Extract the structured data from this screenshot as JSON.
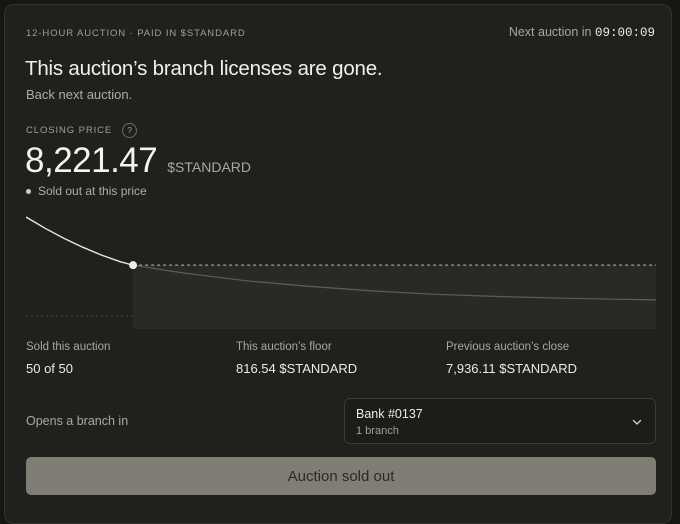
{
  "header": {
    "eyebrow": "12-HOUR AUCTION · PAID IN $STANDARD",
    "next_auction_label": "Next auction in",
    "next_auction_time": "09:00:09"
  },
  "hero": {
    "headline": "This auction’s branch licenses are gone.",
    "subline": "Back next auction."
  },
  "closing": {
    "label": "CLOSING PRICE",
    "help_glyph": "?",
    "price": "8,221.47",
    "currency": "$STANDARD",
    "note": "Sold out at this price"
  },
  "chart_data": {
    "type": "line",
    "series": [
      {
        "values": [
          [
            0,
            1.0
          ],
          [
            0.03,
            0.9
          ],
          [
            0.06,
            0.81
          ],
          [
            0.09,
            0.73
          ],
          [
            0.12,
            0.66
          ],
          [
            0.15,
            0.6
          ],
          [
            0.17,
            0.57
          ]
        ]
      },
      {
        "values": [
          [
            0.17,
            0.57
          ],
          [
            0.25,
            0.5
          ],
          [
            0.35,
            0.43
          ],
          [
            0.45,
            0.38
          ],
          [
            0.55,
            0.34
          ],
          [
            0.65,
            0.31
          ],
          [
            0.75,
            0.29
          ],
          [
            0.85,
            0.275
          ],
          [
            1.0,
            0.26
          ]
        ]
      }
    ],
    "closing_level": 0.57,
    "closing_x": 0.17,
    "grid": false
  },
  "stats": [
    {
      "label": "Sold this auction",
      "value": "50 of 50"
    },
    {
      "label": "This auction’s floor",
      "value": "816.54 $STANDARD"
    },
    {
      "label": "Previous auction’s close",
      "value": "7,936.11 $STANDARD"
    }
  ],
  "branch": {
    "label": "Opens a branch in",
    "selected_name": "Bank #0137",
    "selected_count": "1 branch"
  },
  "action": {
    "button_label": "Auction sold out"
  }
}
